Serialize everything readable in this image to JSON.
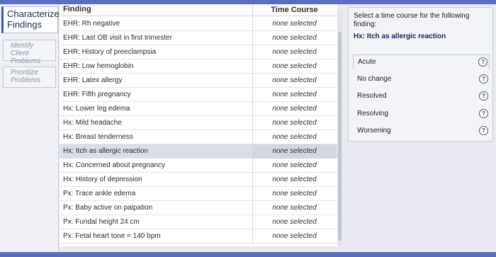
{
  "nav": {
    "active": "Characterize Findings",
    "items": [
      "Identify Client Problems",
      "Prioritize Problems"
    ]
  },
  "table": {
    "headers": [
      "Finding",
      "Time Course"
    ],
    "rows": [
      {
        "finding": "EHR: Rh negative",
        "time_course": "none selected"
      },
      {
        "finding": "EHR: Last OB visit in first trimester",
        "time_course": "none selected"
      },
      {
        "finding": "EHR: History of preeclampsia",
        "time_course": "none selected"
      },
      {
        "finding": "EHR: Low hemoglobin",
        "time_course": "none selected"
      },
      {
        "finding": "EHR: Latex allergy",
        "time_course": "none selected"
      },
      {
        "finding": "EHR: Fifth pregnancy",
        "time_course": "none selected"
      },
      {
        "finding": "Hx: Lower leg edema",
        "time_course": "none selected"
      },
      {
        "finding": "Hx: Mild headache",
        "time_course": "none selected"
      },
      {
        "finding": "Hx: Breast tenderness",
        "time_course": "none selected"
      },
      {
        "finding": "Hx: Itch as allergic reaction",
        "time_course": "none selected",
        "selected": true
      },
      {
        "finding": "Hx: Concerned about pregnancy",
        "time_course": "none selected"
      },
      {
        "finding": "Hx: History of depression",
        "time_course": "none selected"
      },
      {
        "finding": "Px: Trace ankle edema",
        "time_course": "none selected"
      },
      {
        "finding": "Px: Baby active on palpation",
        "time_course": "none selected"
      },
      {
        "finding": "Px: Fundal height 24 cm",
        "time_course": "none selected"
      },
      {
        "finding": "Px: Fetal heart tone = 140 bpm",
        "time_course": "none selected"
      }
    ]
  },
  "panel": {
    "prompt": "Select a time course for the following finding:",
    "finding": "Hx: Itch as allergic reaction",
    "options": [
      "Acute",
      "No change",
      "Resolved",
      "Resolving",
      "Worsening"
    ],
    "help_glyph": "?"
  },
  "colors": {
    "accent": "#5a6fc0",
    "selected_row": "#dcdee6",
    "panel_bg": "#f3f4f8"
  }
}
